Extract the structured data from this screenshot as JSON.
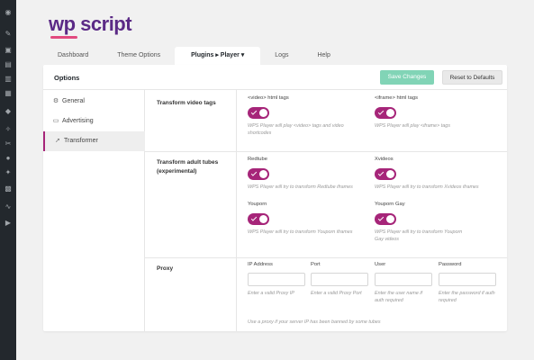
{
  "brand": {
    "name": "wp script"
  },
  "tabs": [
    {
      "label": "Dashboard"
    },
    {
      "label": "Theme Options"
    },
    {
      "label": "Plugins ▸ Player ▾"
    },
    {
      "label": "Logs"
    },
    {
      "label": "Help"
    }
  ],
  "header": {
    "title": "Options",
    "save_label": "Save Changes",
    "reset_label": "Reset to Defaults"
  },
  "nav": [
    {
      "label": "General",
      "icon": "gear-icon"
    },
    {
      "label": "Advertising",
      "icon": "ad-icon"
    },
    {
      "label": "Transformer",
      "icon": "rocket-icon"
    }
  ],
  "sections": {
    "video_tags": {
      "label": "Transform video tags",
      "items": [
        {
          "title": "<video> html tags",
          "on": true,
          "help": "WPS Player will play <video> tags and video shortcodes"
        },
        {
          "title": "<iframe> html tags",
          "on": true,
          "help": "WPS Player will play <iframe> tags"
        }
      ]
    },
    "adult_tubes": {
      "label": "Transform adult tubes (experimental)",
      "items": [
        {
          "title": "Redtube",
          "on": true,
          "help": "WPS Player will try to transform Redtube iframes"
        },
        {
          "title": "Xvideos",
          "on": true,
          "help": "WPS Player will try to transform Xvideos iframes"
        },
        {
          "title": "Youporn",
          "on": true,
          "help": "WPS Player will try to transform Youporn iframes"
        },
        {
          "title": "Youporn Gay",
          "on": true,
          "help": "WPS Player will try to transform Youporn Gay videos"
        }
      ]
    },
    "proxy": {
      "label": "Proxy",
      "fields": [
        {
          "label": "IP Address",
          "value": "",
          "help": "Enter a valid Proxy IP"
        },
        {
          "label": "Port",
          "value": "",
          "help": "Enter a valid Proxy Port"
        },
        {
          "label": "User",
          "value": "",
          "help": "Enter the user name if auth required"
        },
        {
          "label": "Password",
          "value": "",
          "help": "Enter the password if auth required"
        }
      ],
      "note": "Use a proxy if your server IP has been banned by some tubes"
    }
  },
  "colors": {
    "accent": "#a62579",
    "save": "#81d4b6",
    "brand": "#5b2a86"
  }
}
